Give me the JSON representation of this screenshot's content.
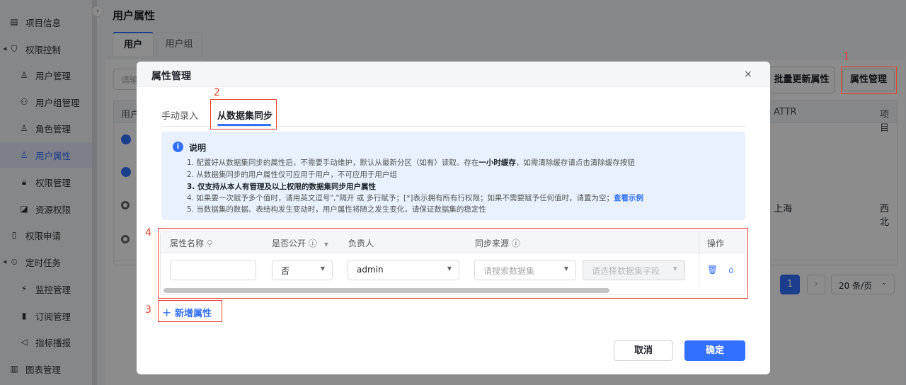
{
  "sidebar": {
    "items": [
      {
        "label": "项目信息",
        "icon": "list-icon"
      },
      {
        "label": "权限控制",
        "icon": "shield-icon"
      },
      {
        "label": "用户管理",
        "icon": "user-icon"
      },
      {
        "label": "用户组管理",
        "icon": "users-icon"
      },
      {
        "label": "角色管理",
        "icon": "role-icon"
      },
      {
        "label": "用户属性",
        "icon": "user-attr-icon",
        "active": true
      },
      {
        "label": "权限管理",
        "icon": "lock-icon"
      },
      {
        "label": "资源权限",
        "icon": "resource-icon"
      },
      {
        "label": "权限申请",
        "icon": "file-icon"
      },
      {
        "label": "定时任务",
        "icon": "clock-icon"
      },
      {
        "label": "监控管理",
        "icon": "monitor-icon"
      },
      {
        "label": "订阅管理",
        "icon": "bookmark-icon"
      },
      {
        "label": "指标播报",
        "icon": "speaker-icon"
      },
      {
        "label": "图表管理",
        "icon": "bar-chart-icon"
      }
    ]
  },
  "page": {
    "title": "用户属性",
    "tabs": [
      "用户",
      "用户组"
    ],
    "search_placeholder": "请输",
    "batch_update": "批量更新属性",
    "attr_manage": "属性管理",
    "table": {
      "headers": [
        "用户",
        "ATTR",
        "项目"
      ],
      "row3": [
        "上海",
        "西北"
      ]
    },
    "pagination": {
      "current": "1",
      "page_size": "20 条/页"
    }
  },
  "modal": {
    "title": "属性管理",
    "tabs": [
      "手动录入",
      "从数据集同步"
    ],
    "info": {
      "title": "说明",
      "lines": [
        "1. 配置好从数据集同步的属性后，不需要手动维护，默认从最新分区（如有）读取。存在",
        "一小时缓存",
        "，如需清除缓存请点击清除缓存按钮",
        "2. 从数据集同步的用户属性仅可应用于用户，不可应用于用户组",
        "3. 仅支持从本人有管理及以上权限的数据集同步用户属性",
        "4. 如果要一次赋予多个值时，请用英文逗号\",\"隔开 或 多行赋予；[*]表示拥有所有行权限；如果不需要赋予任何值时，请置为空；",
        "查看示例",
        "5. 当数据集的数据、表结构发生变动时，用户属性将随之发生变化，请保证数据集的稳定性"
      ]
    },
    "table": {
      "headers": [
        "属性名称",
        "是否公开",
        "负责人",
        "同步来源",
        "操作"
      ],
      "row": {
        "name": "",
        "public": "否",
        "owner": "admin",
        "dataset_placeholder": "请搜索数据集",
        "field_placeholder": "请选择数据集字段"
      }
    },
    "add_label": "新增属性",
    "cancel": "取消",
    "ok": "确定"
  },
  "annotations": [
    "1",
    "2",
    "3",
    "4"
  ],
  "colors": {
    "primary": "#3370ff",
    "annotation": "#e8412c"
  }
}
